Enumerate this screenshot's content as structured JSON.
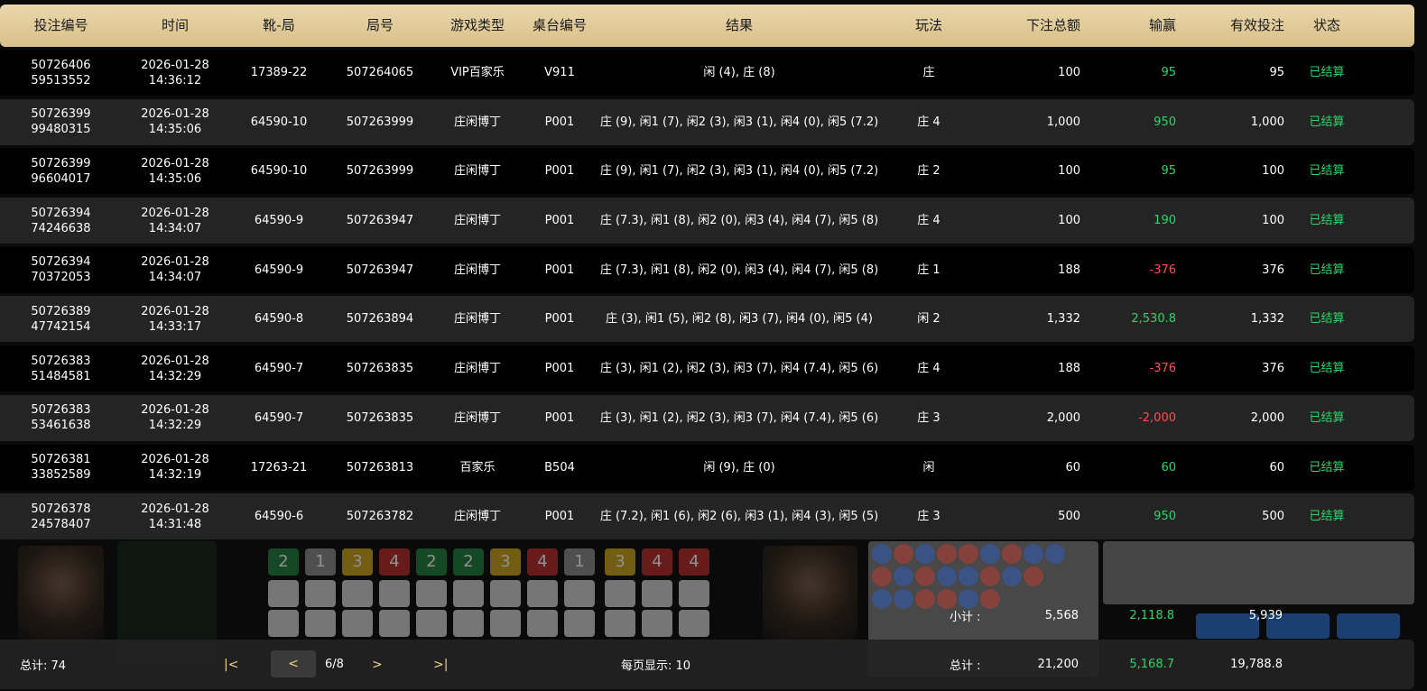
{
  "columns": [
    "投注编号",
    "时间",
    "靴-局",
    "局号",
    "游戏类型",
    "桌台编号",
    "结果",
    "玩法",
    "下注总额",
    "输赢",
    "有效投注",
    "状态"
  ],
  "rows": [
    {
      "bet_id_a": "50726406",
      "bet_id_b": "59513552",
      "date": "2026-01-28",
      "time": "14:36:12",
      "shoe": "17389-22",
      "round": "507264065",
      "game": "VIP百家乐",
      "table": "V911",
      "result": "闲 (4), 庄 (8)",
      "play": "庄",
      "amount": "100",
      "winloss": "95",
      "winloss_type": "win",
      "valid": "95",
      "status": "已结算"
    },
    {
      "bet_id_a": "50726399",
      "bet_id_b": "99480315",
      "date": "2026-01-28",
      "time": "14:35:06",
      "shoe": "64590-10",
      "round": "507263999",
      "game": "庄闲博丁",
      "table": "P001",
      "result": "庄 (9), 闲1 (7), 闲2 (3), 闲3 (1), 闲4 (0), 闲5 (7.2)",
      "play": "庄 4",
      "amount": "1,000",
      "winloss": "950",
      "winloss_type": "win",
      "valid": "1,000",
      "status": "已结算"
    },
    {
      "bet_id_a": "50726399",
      "bet_id_b": "96604017",
      "date": "2026-01-28",
      "time": "14:35:06",
      "shoe": "64590-10",
      "round": "507263999",
      "game": "庄闲博丁",
      "table": "P001",
      "result": "庄 (9), 闲1 (7), 闲2 (3), 闲3 (1), 闲4 (0), 闲5 (7.2)",
      "play": "庄 2",
      "amount": "100",
      "winloss": "95",
      "winloss_type": "win",
      "valid": "100",
      "status": "已结算"
    },
    {
      "bet_id_a": "50726394",
      "bet_id_b": "74246638",
      "date": "2026-01-28",
      "time": "14:34:07",
      "shoe": "64590-9",
      "round": "507263947",
      "game": "庄闲博丁",
      "table": "P001",
      "result": "庄 (7.3), 闲1 (8), 闲2 (0), 闲3 (4), 闲4 (7), 闲5 (8)",
      "play": "庄 4",
      "amount": "100",
      "winloss": "190",
      "winloss_type": "win",
      "valid": "100",
      "status": "已结算"
    },
    {
      "bet_id_a": "50726394",
      "bet_id_b": "70372053",
      "date": "2026-01-28",
      "time": "14:34:07",
      "shoe": "64590-9",
      "round": "507263947",
      "game": "庄闲博丁",
      "table": "P001",
      "result": "庄 (7.3), 闲1 (8), 闲2 (0), 闲3 (4), 闲4 (7), 闲5 (8)",
      "play": "庄 1",
      "amount": "188",
      "winloss": "-376",
      "winloss_type": "lose",
      "valid": "376",
      "status": "已结算"
    },
    {
      "bet_id_a": "50726389",
      "bet_id_b": "47742154",
      "date": "2026-01-28",
      "time": "14:33:17",
      "shoe": "64590-8",
      "round": "507263894",
      "game": "庄闲博丁",
      "table": "P001",
      "result": "庄 (3), 闲1 (5), 闲2 (8), 闲3 (7), 闲4 (0), 闲5 (4)",
      "play": "闲 2",
      "amount": "1,332",
      "winloss": "2,530.8",
      "winloss_type": "win",
      "valid": "1,332",
      "status": "已结算"
    },
    {
      "bet_id_a": "50726383",
      "bet_id_b": "51484581",
      "date": "2026-01-28",
      "time": "14:32:29",
      "shoe": "64590-7",
      "round": "507263835",
      "game": "庄闲博丁",
      "table": "P001",
      "result": "庄 (3), 闲1 (2), 闲2 (3), 闲3 (7), 闲4 (7.4), 闲5 (6)",
      "play": "庄 4",
      "amount": "188",
      "winloss": "-376",
      "winloss_type": "lose",
      "valid": "376",
      "status": "已结算"
    },
    {
      "bet_id_a": "50726383",
      "bet_id_b": "53461638",
      "date": "2026-01-28",
      "time": "14:32:29",
      "shoe": "64590-7",
      "round": "507263835",
      "game": "庄闲博丁",
      "table": "P001",
      "result": "庄 (3), 闲1 (2), 闲2 (3), 闲3 (7), 闲4 (7.4), 闲5 (6)",
      "play": "庄 3",
      "amount": "2,000",
      "winloss": "-2,000",
      "winloss_type": "lose",
      "valid": "2,000",
      "status": "已结算"
    },
    {
      "bet_id_a": "50726381",
      "bet_id_b": "33852589",
      "date": "2026-01-28",
      "time": "14:32:19",
      "shoe": "17263-21",
      "round": "507263813",
      "game": "百家乐",
      "table": "B504",
      "result": "闲 (9), 庄 (0)",
      "play": "闲",
      "amount": "60",
      "winloss": "60",
      "winloss_type": "win",
      "valid": "60",
      "status": "已结算"
    },
    {
      "bet_id_a": "50726378",
      "bet_id_b": "24578407",
      "date": "2026-01-28",
      "time": "14:31:48",
      "shoe": "64590-6",
      "round": "507263782",
      "game": "庄闲博丁",
      "table": "P001",
      "result": "庄 (7.2), 闲1 (6), 闲2 (6), 闲3 (1), 闲4 (3), 闲5 (5)",
      "play": "庄 3",
      "amount": "500",
      "winloss": "950",
      "winloss_type": "win",
      "valid": "500",
      "status": "已结算"
    }
  ],
  "subtotal": {
    "label": "小计 :",
    "amount": "5,568",
    "winloss": "2,118.8",
    "valid": "5,939"
  },
  "footer": {
    "total_count_label": "总计:  74",
    "first_label": "|<",
    "prev_label": "<",
    "page_label": "6/8",
    "next_label": ">",
    "last_label": ">|",
    "per_page_label": "每页显示:  10",
    "total_label": "总计 :",
    "total_amount": "21,200",
    "total_winloss": "5,168.7",
    "total_valid": "19,788.8"
  },
  "colors": {
    "header_bg": "#e3cc9a",
    "win": "#2fd26b",
    "lose": "#ff4d4f",
    "pager_accent": "#f0d28a"
  }
}
